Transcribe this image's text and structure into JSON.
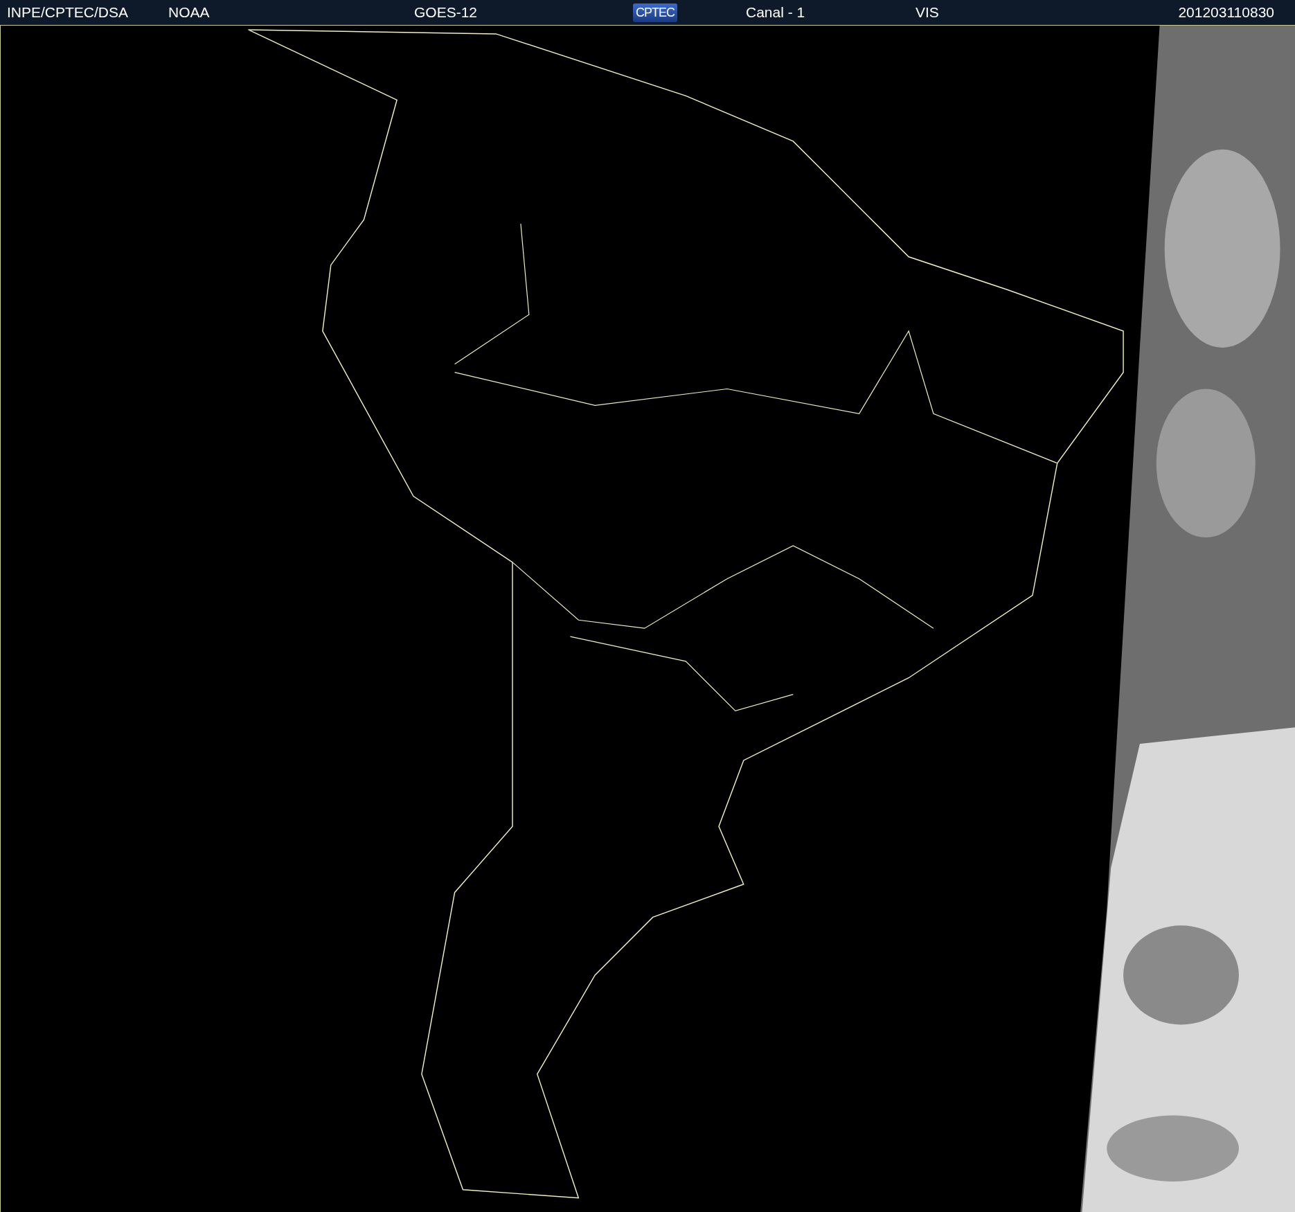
{
  "header": {
    "agency": "INPE/CPTEC/DSA",
    "source": "NOAA",
    "satellite": "GOES-12",
    "logo": "CPTEC",
    "channel": "Canal - 1",
    "band": "VIS",
    "timestamp": "201203110830"
  }
}
